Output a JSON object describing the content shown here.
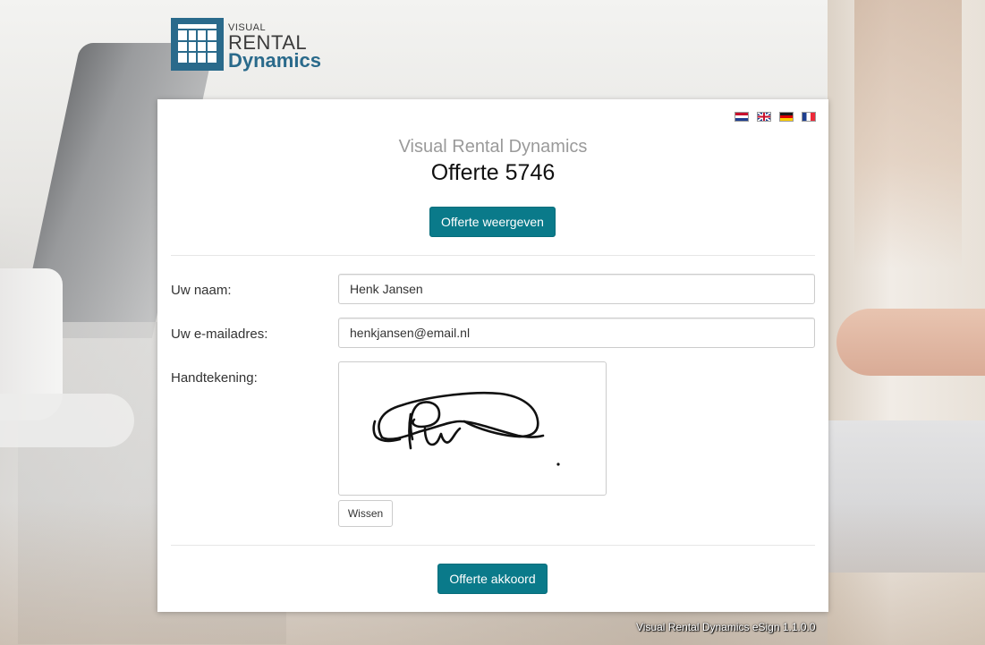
{
  "logo": {
    "line1": "VISUAL",
    "line2": "RENTAL",
    "line3": "Dynamics"
  },
  "languages": [
    {
      "name": "Nederlands",
      "icon": "flag-nl-icon"
    },
    {
      "name": "English",
      "icon": "flag-gb-icon"
    },
    {
      "name": "Deutsch",
      "icon": "flag-de-icon"
    },
    {
      "name": "Français",
      "icon": "flag-fr-icon"
    }
  ],
  "header": {
    "subtitle": "Visual Rental Dynamics",
    "title": "Offerte 5746"
  },
  "actions": {
    "view_label": "Offerte weergeven",
    "accept_label": "Offerte akkoord",
    "clear_label": "Wissen"
  },
  "form": {
    "name_label": "Uw naam:",
    "name_value": "Henk Jansen",
    "email_label": "Uw e-mailadres:",
    "email_value": "henkjansen@email.nl",
    "signature_label": "Handtekening:"
  },
  "footer": {
    "version_text": "Visual Rental Dynamics eSign 1.1.0.0"
  },
  "colors": {
    "primary_button": "#0a7a8a",
    "brand_blue": "#2a6a8b"
  }
}
